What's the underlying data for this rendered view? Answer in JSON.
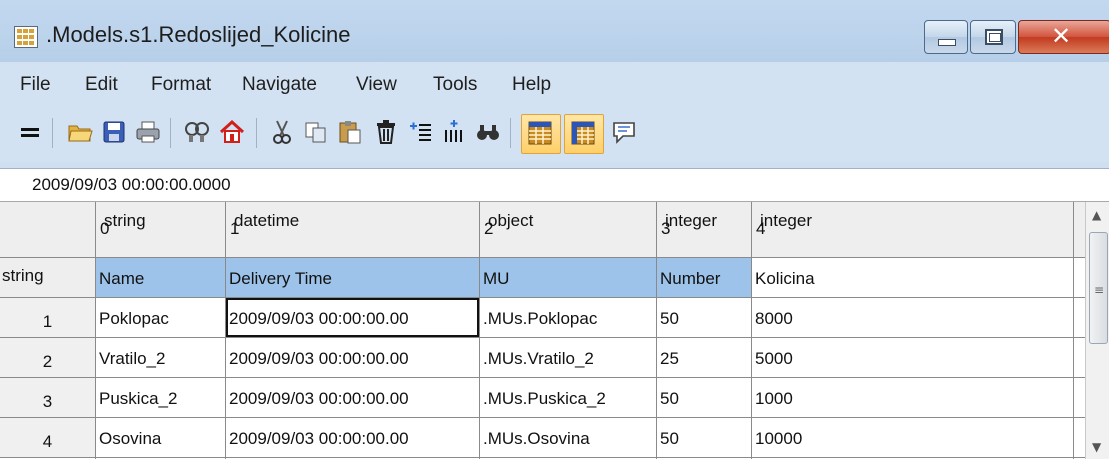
{
  "window": {
    "title": ".Models.s1.Redoslijed_Kolicine",
    "controls": {
      "minimize_icon": "minimize-icon",
      "maximize_icon": "maximize-icon",
      "close_glyph": "✕"
    }
  },
  "menu": [
    "File",
    "Edit",
    "Format",
    "Navigate",
    "View",
    "Tools",
    "Help"
  ],
  "toolbar": {
    "icons": [
      "equals-icon",
      "open-folder-icon",
      "save-icon",
      "print-icon",
      "inherit-icon",
      "home-icon",
      "cut-icon",
      "copy-icon",
      "paste-icon",
      "delete-icon",
      "insert-rows-icon",
      "insert-columns-icon",
      "find-icon",
      "show-header-icon",
      "show-index-icon",
      "comment-icon"
    ],
    "active": [
      "show-header-icon",
      "show-index-icon"
    ]
  },
  "cell_value": "2009/09/03 00:00:00.0000",
  "grid": {
    "column_types": [
      "string",
      "datetime",
      "object",
      "integer",
      "integer"
    ],
    "column_indices": [
      "0",
      "1",
      "2",
      "3",
      "4"
    ],
    "row_header_label": "string",
    "column_names": [
      "Name",
      "Delivery Time",
      "MU",
      "Number",
      "Kolicina"
    ],
    "rows": [
      {
        "index": "1",
        "cells": [
          "Poklopac",
          "2009/09/03 00:00:00.00",
          ".MUs.Poklopac",
          "50",
          "8000"
        ]
      },
      {
        "index": "2",
        "cells": [
          "Vratilo_2",
          "2009/09/03 00:00:00.00",
          ".MUs.Vratilo_2",
          "25",
          "5000"
        ]
      },
      {
        "index": "3",
        "cells": [
          "Puskica_2",
          "2009/09/03 00:00:00.00",
          ".MUs.Puskica_2",
          "50",
          "1000"
        ]
      },
      {
        "index": "4",
        "cells": [
          "Osovina",
          "2009/09/03 00:00:00.00",
          ".MUs.Osovina",
          "50",
          "10000"
        ]
      }
    ]
  },
  "scrollbar": {
    "up": "▲",
    "down": "▼",
    "grip": "≡"
  }
}
